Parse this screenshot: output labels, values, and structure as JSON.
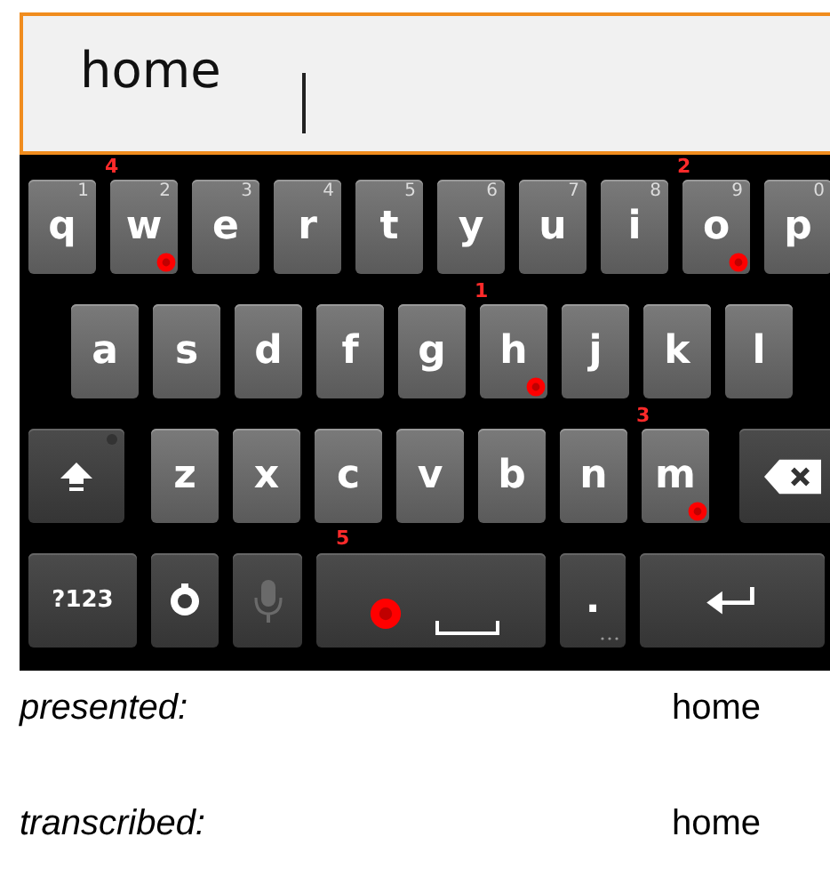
{
  "text_field": {
    "value": "home"
  },
  "keyboard": {
    "rows": [
      {
        "keys": [
          {
            "kind": "letter",
            "label": "q",
            "hint": "1"
          },
          {
            "kind": "letter",
            "label": "w",
            "hint": "2",
            "touch": "4"
          },
          {
            "kind": "letter",
            "label": "e",
            "hint": "3"
          },
          {
            "kind": "letter",
            "label": "r",
            "hint": "4"
          },
          {
            "kind": "letter",
            "label": "t",
            "hint": "5"
          },
          {
            "kind": "letter",
            "label": "y",
            "hint": "6"
          },
          {
            "kind": "letter",
            "label": "u",
            "hint": "7"
          },
          {
            "kind": "letter",
            "label": "i",
            "hint": "8"
          },
          {
            "kind": "letter",
            "label": "o",
            "hint": "9",
            "touch": "2"
          },
          {
            "kind": "letter",
            "label": "p",
            "hint": "0"
          }
        ]
      },
      {
        "keys": [
          {
            "kind": "letter",
            "label": "a"
          },
          {
            "kind": "letter",
            "label": "s"
          },
          {
            "kind": "letter",
            "label": "d"
          },
          {
            "kind": "letter",
            "label": "f"
          },
          {
            "kind": "letter",
            "label": "g"
          },
          {
            "kind": "letter",
            "label": "h",
            "touch": "1"
          },
          {
            "kind": "letter",
            "label": "j"
          },
          {
            "kind": "letter",
            "label": "k"
          },
          {
            "kind": "letter",
            "label": "l"
          }
        ]
      },
      {
        "keys": [
          {
            "kind": "shift",
            "on": false
          },
          {
            "kind": "letter",
            "label": "z"
          },
          {
            "kind": "letter",
            "label": "x"
          },
          {
            "kind": "letter",
            "label": "c"
          },
          {
            "kind": "letter",
            "label": "v"
          },
          {
            "kind": "letter",
            "label": "b"
          },
          {
            "kind": "letter",
            "label": "n"
          },
          {
            "kind": "letter",
            "label": "m",
            "touch": "3"
          },
          {
            "kind": "delete"
          }
        ]
      },
      {
        "keys": [
          {
            "kind": "symbols",
            "label": "?123"
          },
          {
            "kind": "settings"
          },
          {
            "kind": "mic",
            "disabled": true
          },
          {
            "kind": "space",
            "touch": "5"
          },
          {
            "kind": "period",
            "label": "."
          },
          {
            "kind": "enter"
          }
        ]
      }
    ]
  },
  "results": [
    {
      "label": "presented:",
      "value": "home"
    },
    {
      "label": "transcribed:",
      "value": "home"
    }
  ]
}
